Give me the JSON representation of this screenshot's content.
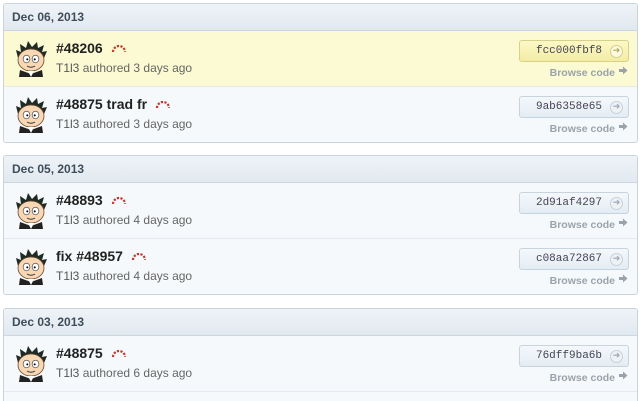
{
  "groups": [
    {
      "date": "Dec 06, 2013",
      "commits": [
        {
          "message": "#48206",
          "author": "T1l3",
          "time": "authored 3 days ago",
          "sha": "fcc000fbf8",
          "browse": "Browse code",
          "highlight": true
        },
        {
          "message": "#48875 trad fr",
          "author": "T1l3",
          "time": "authored 3 days ago",
          "sha": "9ab6358e65",
          "browse": "Browse code",
          "highlight": false
        }
      ]
    },
    {
      "date": "Dec 05, 2013",
      "commits": [
        {
          "message": "#48893",
          "author": "T1l3",
          "time": "authored 4 days ago",
          "sha": "2d91af4297",
          "browse": "Browse code",
          "highlight": false
        },
        {
          "message": "fix #48957",
          "author": "T1l3",
          "time": "authored 4 days ago",
          "sha": "c08aa72867",
          "browse": "Browse code",
          "highlight": false
        }
      ]
    },
    {
      "date": "Dec 03, 2013",
      "commits": [
        {
          "message": "#48875",
          "author": "T1l3",
          "time": "authored 6 days ago",
          "sha": "76dff9ba6b",
          "browse": "Browse code",
          "highlight": false
        }
      ]
    }
  ],
  "icons": {
    "status": "build-status-icon",
    "sha_go": "circle-arrow-icon",
    "browse_arrow": "arrow-right-icon",
    "avatar": "avatar"
  },
  "colors": {
    "highlight_bg": "#fbfad2",
    "status_icon": "#c0392b"
  }
}
